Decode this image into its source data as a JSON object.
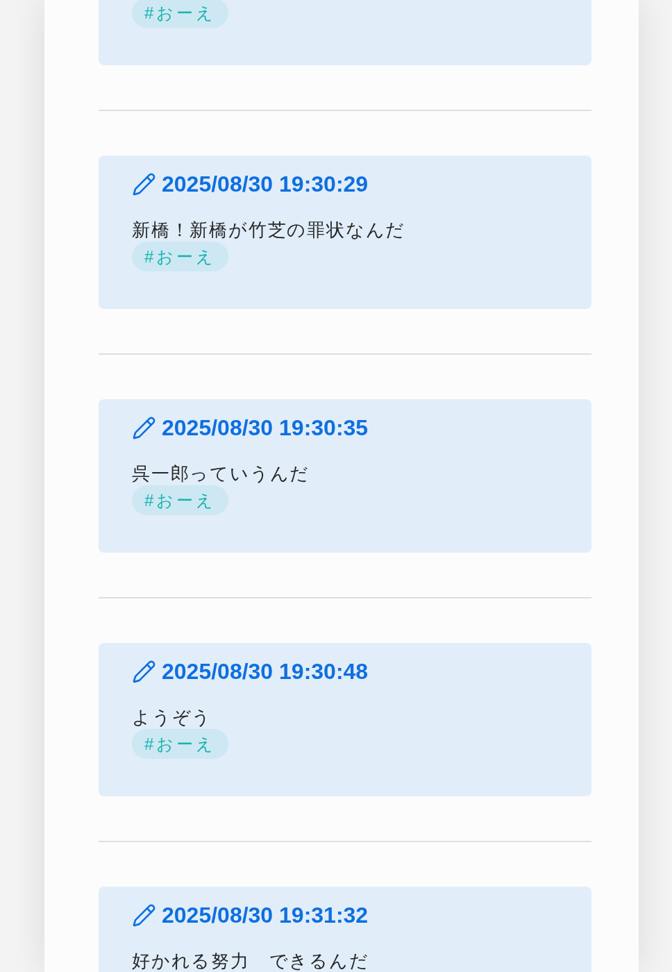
{
  "posts": [
    {
      "tags": [
        "#おーえ"
      ]
    },
    {
      "timestamp": "2025/08/30 19:30:29",
      "body": "新橋！新橋が竹芝の罪状なんだ",
      "tags": [
        "#おーえ"
      ]
    },
    {
      "timestamp": "2025/08/30 19:30:35",
      "body": "呉一郎っていうんだ",
      "tags": [
        "#おーえ"
      ]
    },
    {
      "timestamp": "2025/08/30 19:30:48",
      "body": "ようぞう",
      "tags": [
        "#おーえ"
      ]
    },
    {
      "timestamp": "2025/08/30 19:31:32",
      "body": "好かれる努力　できるんだ"
    }
  ]
}
